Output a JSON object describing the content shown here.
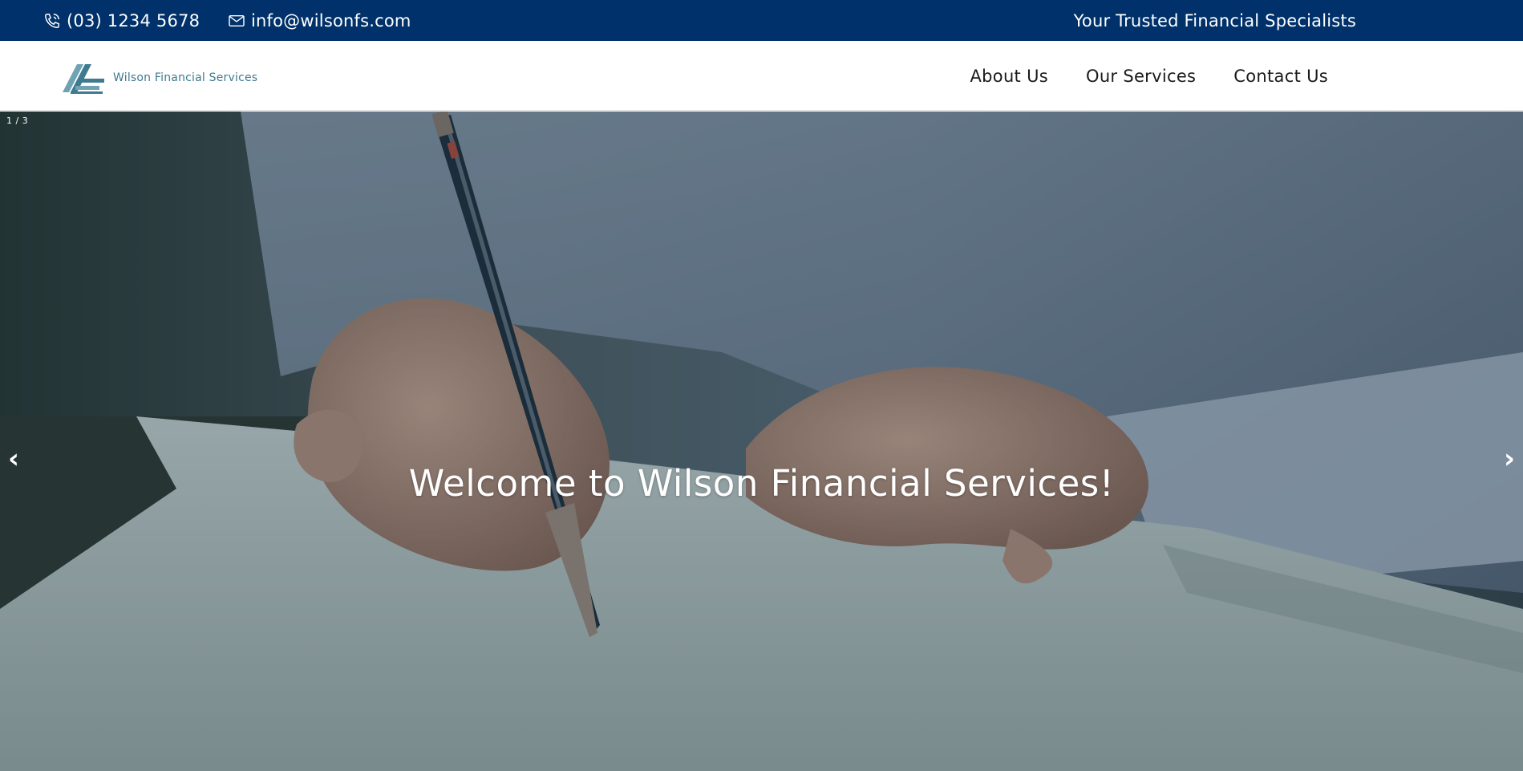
{
  "topbar": {
    "phone": "(03) 1234 5678",
    "email": "info@wilsonfs.com",
    "tagline": "Your Trusted Financial Specialists",
    "background_color": "#00316a"
  },
  "header": {
    "logo_text": "Wilson Financial Services",
    "nav": [
      "About Us",
      "Our Services",
      "Contact Us"
    ]
  },
  "hero": {
    "slide_counter": "1 / 3",
    "title": "Welcome to Wilson Financial Services!",
    "prev_arrow": "‹",
    "next_arrow": "›"
  },
  "icons": {
    "phone": "phone-icon",
    "email": "envelope-icon",
    "logo": "triangle-stripes-logo"
  },
  "colors": {
    "brand_dark": "#00316a",
    "logo_teal": "#3e7a90"
  }
}
